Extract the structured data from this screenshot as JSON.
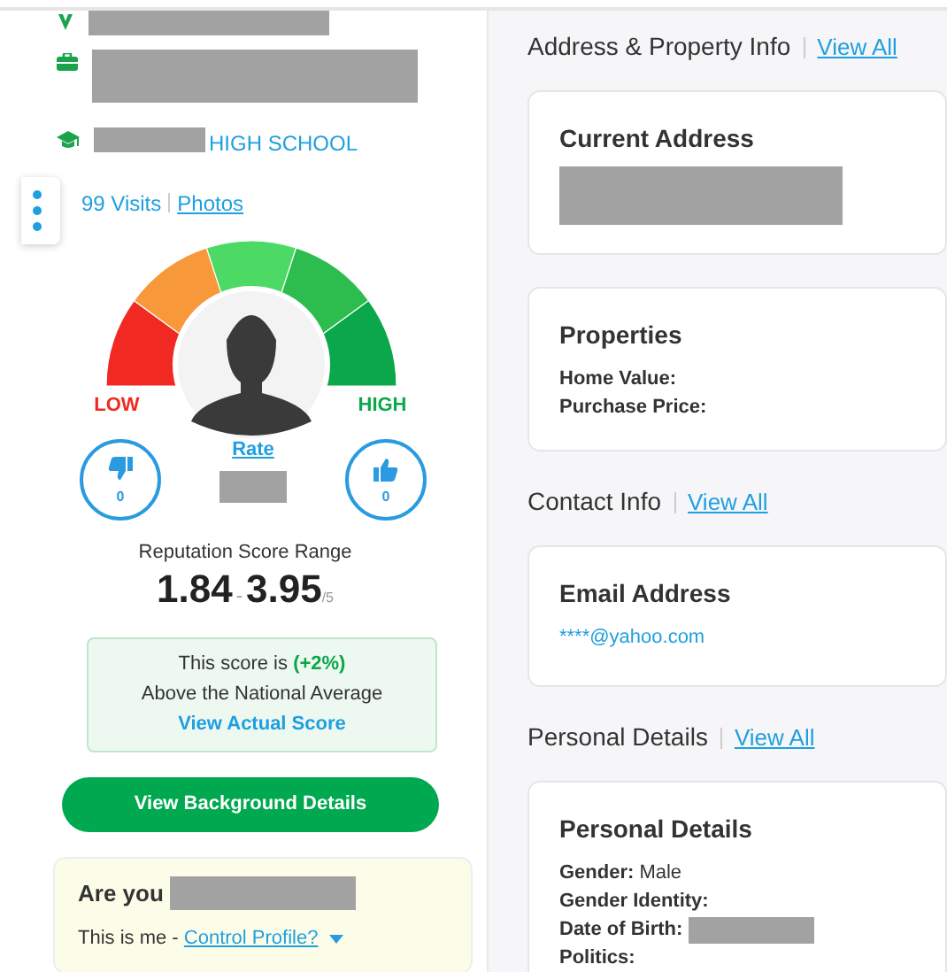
{
  "profile": {
    "details": [
      {
        "kind": "location"
      },
      {
        "kind": "work"
      },
      {
        "kind": "school",
        "text": "HIGH SCHOOL"
      }
    ],
    "visits": "99 Visits",
    "photos_link": "Photos"
  },
  "gauge": {
    "low_label": "LOW",
    "high_label": "HIGH"
  },
  "votes": {
    "dislikes": "0",
    "rate_link": "Rate",
    "likes": "0"
  },
  "score": {
    "title": "Reputation Score Range",
    "low": "1.84",
    "separator": "-",
    "high": "3.95",
    "scale": "/5"
  },
  "average": {
    "line_1": "This score is **(+2%)**",
    "line_2": "Above the National Average",
    "link": "View Actual Score"
  },
  "background_button": "View Background Details",
  "claim": {
    "title": "Are you",
    "text": "This is me - ",
    "link": "Control Profile?"
  },
  "sections": [
    {
      "title": "Address & Property Info",
      "link": "View All",
      "cards": [
        {
          "title": "Current Address",
          "redacted": true
        },
        {
          "title": "Properties",
          "rows": [
            {
              "label": "Home Value:"
            },
            {
              "label": "Purchase Price:"
            }
          ]
        }
      ]
    },
    {
      "title": "Contact Info",
      "link": "View All",
      "cards": [
        {
          "title": "Email Address",
          "email": "****@yahoo.com"
        }
      ]
    },
    {
      "title": "Personal Details",
      "link": "View All",
      "cards": [
        {
          "title": "Personal Details",
          "rows": [
            {
              "label": "Gender:",
              "value": "Male"
            },
            {
              "label": "Gender Identity:"
            },
            {
              "label": "Date of Birth:",
              "redacted": true
            },
            {
              "label": "Politics:"
            }
          ]
        }
      ]
    }
  ]
}
